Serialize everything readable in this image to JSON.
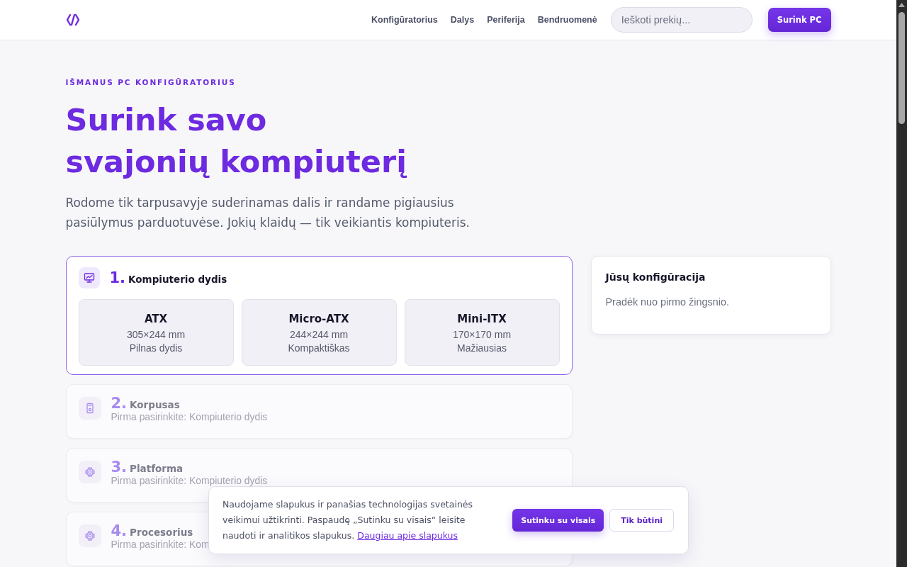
{
  "header": {
    "nav": [
      {
        "label": "Konfigūratorius"
      },
      {
        "label": "Dalys"
      },
      {
        "label": "Periferija"
      },
      {
        "label": "Bendruomenė"
      }
    ],
    "search": {
      "placeholder": "Ieškoti prekių..."
    },
    "cta": "Surink PC"
  },
  "hero": {
    "kicker": "IŠMANUS PC KONFIGŪRATORIUS",
    "title_lines": [
      "Surink savo",
      "svajonių kompiuterį"
    ],
    "lead": "Rodome tik tarpusavyje suderinamas dalis ir randame pigiausius pasiūlymus parduotuvėse. Jokių klaidų — tik veikiantis kompiuteris."
  },
  "steps": [
    {
      "number": "1.",
      "title": "Kompiuterio dydis",
      "locked": false,
      "options": [
        {
          "name": "ATX",
          "size": "305×244 mm",
          "note": "Pilnas dydis",
          "selected": false
        },
        {
          "name": "Micro-ATX",
          "size": "244×244 mm",
          "note": "Kompaktiškas",
          "selected": false
        },
        {
          "name": "Mini-ITX",
          "size": "170×170 mm",
          "note": "Mažiausias",
          "selected": false
        }
      ]
    },
    {
      "number": "2.",
      "title": "Korpusas",
      "locked": true,
      "hint": "Pirma pasirinkite: Kompiuterio dydis"
    },
    {
      "number": "3.",
      "title": "Platforma",
      "locked": true,
      "hint": "Pirma pasirinkite: Kompiuterio dydis"
    },
    {
      "number": "4.",
      "title": "Procesorius",
      "locked": true,
      "hint": "Pirma pasirinkite: Kom"
    }
  ],
  "summary": {
    "title": "Jūsų konfigūracija",
    "text": "Pradėk nuo pirmo žingsnio."
  },
  "cookie_banner": {
    "text": "Naudojame slapukus ir panašias technologijas svetainės veikimui užtikrinti. Paspaudę „Sutinku su visais“ leisite naudoti ir analitikos slapukus.",
    "link": "Daugiau apie slapukus",
    "buttons": [
      {
        "label": "Sutinku su visais",
        "kind": "primary"
      },
      {
        "label": "Tik būtini",
        "kind": "secondary"
      }
    ]
  }
}
